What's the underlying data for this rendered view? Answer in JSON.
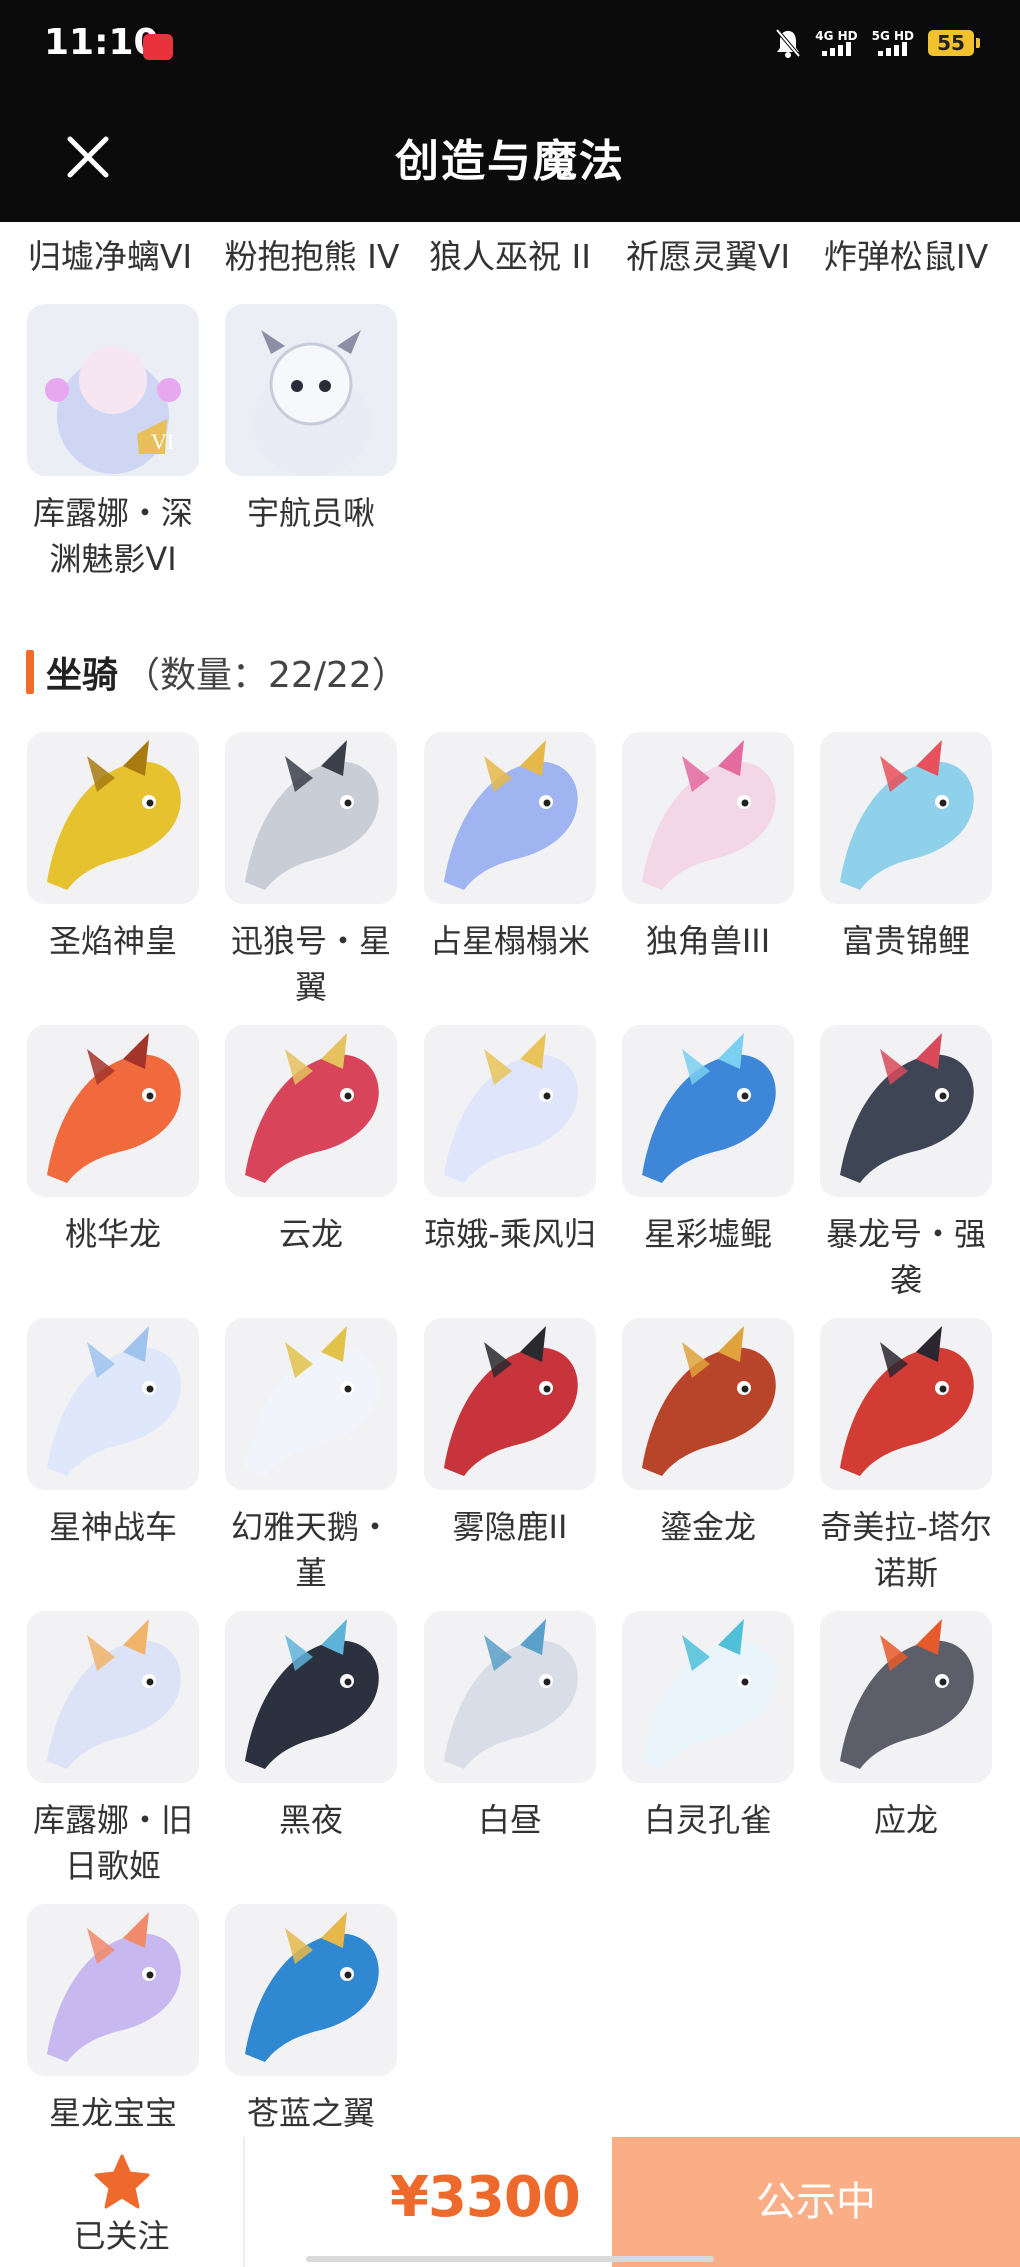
{
  "status_bar": {
    "time": "11:10",
    "network_left": "4G HD",
    "network_right": "5G HD",
    "battery": "55"
  },
  "nav": {
    "title": "创造与魔法"
  },
  "top_row_labels": [
    "归墟净螭VI",
    "粉抱抱熊 IV",
    "狼人巫祝 II",
    "祈愿灵翼VI",
    "炸弹松鼠IV"
  ],
  "pets_tail": [
    {
      "label": "库露娜・深渊魅影VI",
      "color": "#cfd6f3",
      "accent": "#e7a8f0"
    },
    {
      "label": "宇航员啾",
      "color": "#e9ecf5",
      "accent": "#8c8fa6"
    }
  ],
  "mount_section": {
    "title": "坐骑",
    "count": "（数量：22/22）"
  },
  "mounts": [
    {
      "label": "圣焰神皇",
      "color": "#e6c22e",
      "accent": "#a87b10"
    },
    {
      "label": "迅狼号・星翼",
      "color": "#c9cdd6",
      "accent": "#3a3f4a"
    },
    {
      "label": "占星榻榻米",
      "color": "#9fb4f0",
      "accent": "#e6b84a"
    },
    {
      "label": "独角兽III",
      "color": "#f3d7e6",
      "accent": "#e46aa0"
    },
    {
      "label": "富贵锦鲤",
      "color": "#8fd0ea",
      "accent": "#e8505b"
    },
    {
      "label": "桃华龙",
      "color": "#f06a3e",
      "accent": "#a3342a"
    },
    {
      "label": "云龙",
      "color": "#d8445a",
      "accent": "#e6c160"
    },
    {
      "label": "琼娥-乘风归",
      "color": "#dfe6fb",
      "accent": "#e8c45a"
    },
    {
      "label": "星彩墟鲲",
      "color": "#3e86d8",
      "accent": "#7ad0f0"
    },
    {
      "label": "暴龙号・强袭",
      "color": "#3e4656",
      "accent": "#d84a5a"
    },
    {
      "label": "星神战车",
      "color": "#dfe7fb",
      "accent": "#9fc3ec"
    },
    {
      "label": "幻雅天鹅・堇",
      "color": "#f2f4fb",
      "accent": "#e2c24a"
    },
    {
      "label": "雾隐鹿II",
      "color": "#c8343c",
      "accent": "#2a2a2e"
    },
    {
      "label": "鎏金龙",
      "color": "#b8452a",
      "accent": "#e0a23c"
    },
    {
      "label": "奇美拉-塔尔诺斯",
      "color": "#d23c34",
      "accent": "#2b2630"
    },
    {
      "label": "库露娜・旧日歌姬",
      "color": "#dde3f7",
      "accent": "#f0b36a"
    },
    {
      "label": "黑夜",
      "color": "#2c3140",
      "accent": "#5fb3d8"
    },
    {
      "label": "白昼",
      "color": "#d8dde8",
      "accent": "#5aa0c8"
    },
    {
      "label": "白灵孔雀",
      "color": "#eaf4fb",
      "accent": "#4fc0d8"
    },
    {
      "label": "应龙",
      "color": "#5c5f69",
      "accent": "#e65a2c"
    },
    {
      "label": "星龙宝宝",
      "color": "#c8b8f0",
      "accent": "#f08a6a"
    },
    {
      "label": "苍蓝之翼",
      "color": "#2f88d0",
      "accent": "#e6b84a"
    }
  ],
  "bottom": {
    "follow_label": "已关注",
    "price": "¥3300",
    "status_label": "公示中"
  },
  "colors": {
    "accent_orange": "#ee6a2c",
    "button_orange": "#fbae85",
    "header_bg": "#0b0b0b"
  }
}
